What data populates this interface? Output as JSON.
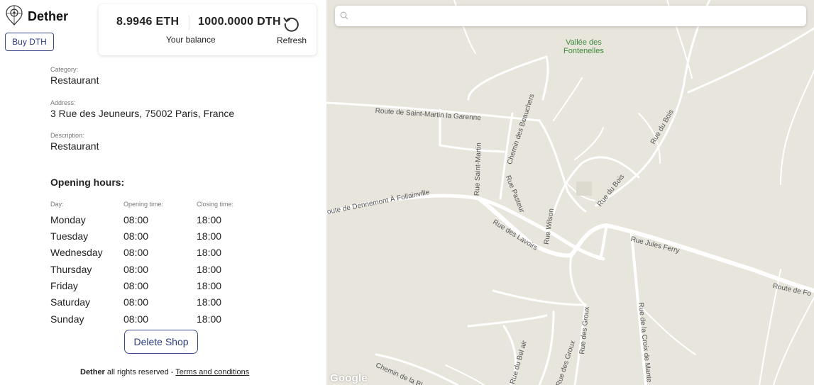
{
  "brand": {
    "name": "Dether",
    "logo_icon": "map-pin-icon"
  },
  "buy_button": "Buy DTH",
  "balance": {
    "eth": "8.9946 ETH",
    "dth": "1000.0000 DTH",
    "label": "Your balance",
    "refresh_label": "Refresh",
    "refresh_icon": "refresh-icon"
  },
  "shop": {
    "category_label": "Category:",
    "category": "Restaurant",
    "address_label": "Address:",
    "address": "3 Rue des Jeuneurs, 75002 Paris, France",
    "description_label": "Description:",
    "description": "Restaurant"
  },
  "opening_hours": {
    "title": "Opening hours:",
    "headers": {
      "day": "Day:",
      "open": "Opening time:",
      "close": "Closing time:"
    },
    "rows": [
      {
        "day": "Monday",
        "open": "08:00",
        "close": "18:00"
      },
      {
        "day": "Tuesday",
        "open": "08:00",
        "close": "18:00"
      },
      {
        "day": "Wednesday",
        "open": "08:00",
        "close": "18:00"
      },
      {
        "day": "Thursday",
        "open": "08:00",
        "close": "18:00"
      },
      {
        "day": "Friday",
        "open": "08:00",
        "close": "18:00"
      },
      {
        "day": "Saturday",
        "open": "08:00",
        "close": "18:00"
      },
      {
        "day": "Sunday",
        "open": "08:00",
        "close": "18:00"
      }
    ]
  },
  "delete_button": "Delete Shop",
  "footer": {
    "brand": "Dether",
    "text": " all rights reserved - ",
    "link": "Terms and conditions"
  },
  "map": {
    "search_placeholder": "",
    "search_icon": "search-icon",
    "place_lines": [
      "Vallée des",
      "Fontenelles"
    ],
    "streets": {
      "saint_martin_garenne": "Route de Saint-Martin la Garenne",
      "chemin_beauchers": "Chemin des Beauchers",
      "rue_saint_martin": "Rue Saint-Martin",
      "rue_du_bois_1": "Rue du Bois",
      "rue_du_bois_2": "Rue du Bois",
      "route_dennemont": "oute de Dennemont À Follainville",
      "rue_pasteur": "Rue Pasteur",
      "rue_lavoirs": "Rue des Lavoirs",
      "rue_wilson": "Rue Wilson",
      "rue_jules_ferry": "Rue Jules Ferry",
      "route_de_fo": "Route de Fo",
      "rue_des_groux_1": "Rue des Groux",
      "rue_des_groux_2": "Rue des Groux",
      "rue_croix_mante": "Rue de la Croix de Mante",
      "rue_bel_air": "Rue du Bel air",
      "chemin_bl": "Chemin de la Bl"
    },
    "attribution": "Google",
    "colors": {
      "land": "#e8e5dc",
      "road": "#ffffff",
      "park_text": "#3e8a3a"
    }
  }
}
